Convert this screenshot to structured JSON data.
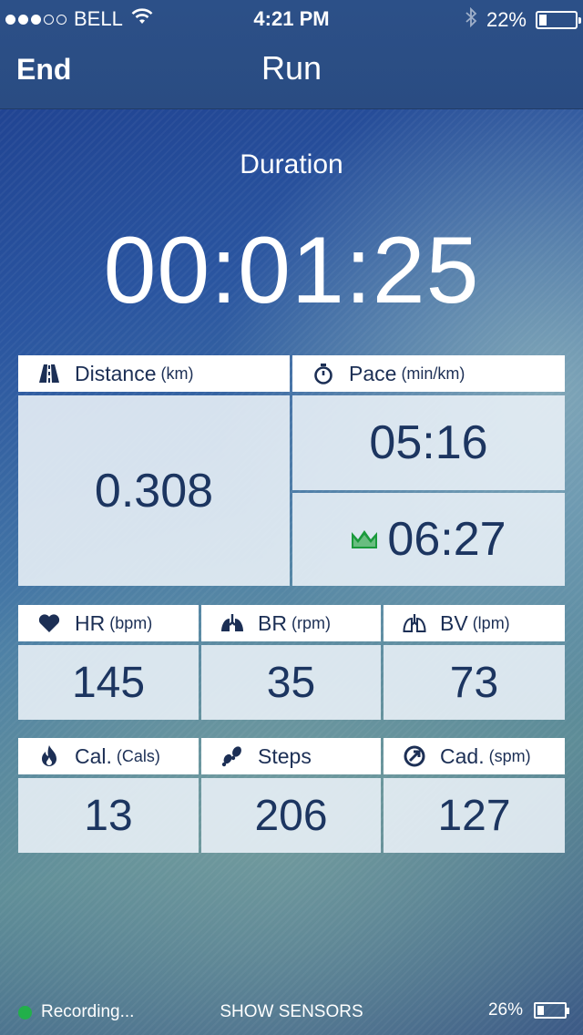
{
  "status_bar": {
    "signal_filled": 3,
    "signal_empty": 2,
    "carrier": "BELL",
    "time": "4:21 PM",
    "battery_text": "22%",
    "battery_level": 0.22,
    "icons": [
      "wifi-icon",
      "bluetooth-icon",
      "battery-icon"
    ]
  },
  "nav": {
    "end_label": "End",
    "title": "Run"
  },
  "duration": {
    "label": "Duration",
    "value": "00:01:25"
  },
  "distance": {
    "label": "Distance",
    "unit": "(km)",
    "value": "0.308",
    "icon": "road-icon"
  },
  "pace": {
    "label": "Pace",
    "unit": "(min/km)",
    "current": "05:16",
    "average": "06:27",
    "icon": "stopwatch-icon",
    "average_icon": "crown-icon",
    "average_icon_color": "#1a9a3c"
  },
  "row2": [
    {
      "label": "HR",
      "unit": "(bpm)",
      "value": "145",
      "icon": "heart-icon"
    },
    {
      "label": "BR",
      "unit": "(rpm)",
      "value": "35",
      "icon": "lungs-icon"
    },
    {
      "label": "BV",
      "unit": "(lpm)",
      "value": "73",
      "icon": "lungs-outline-icon"
    }
  ],
  "row3": [
    {
      "label": "Cal.",
      "unit": "(Cals)",
      "value": "13",
      "icon": "flame-icon"
    },
    {
      "label": "Steps",
      "unit": "",
      "value": "206",
      "icon": "footsteps-icon"
    },
    {
      "label": "Cad.",
      "unit": "(spm)",
      "value": "127",
      "icon": "cadence-icon"
    }
  ],
  "footer": {
    "recording_label": "Recording...",
    "recording_color": "#22b04a",
    "show_sensors_label": "SHOW SENSORS",
    "battery_text": "26%",
    "battery_level": 0.26
  },
  "colors": {
    "tile_text": "#1c3560",
    "nav_bar": "#2c5088"
  }
}
